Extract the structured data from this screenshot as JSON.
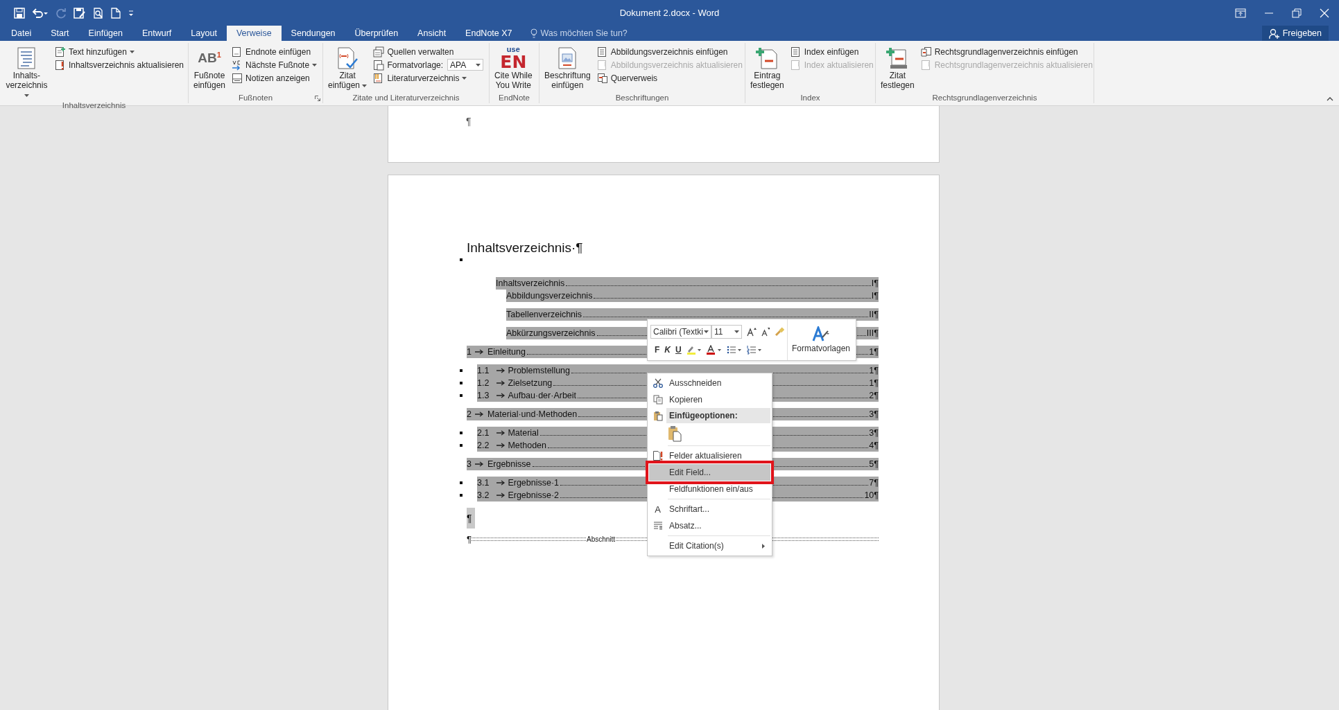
{
  "window": {
    "title": "Dokument 2.docx - Word"
  },
  "tabs": [
    {
      "label": "Datei",
      "selected": false
    },
    {
      "label": "Start",
      "selected": false
    },
    {
      "label": "Einfügen",
      "selected": false
    },
    {
      "label": "Entwurf",
      "selected": false
    },
    {
      "label": "Layout",
      "selected": false
    },
    {
      "label": "Verweise",
      "selected": true
    },
    {
      "label": "Sendungen",
      "selected": false
    },
    {
      "label": "Überprüfen",
      "selected": false
    },
    {
      "label": "Ansicht",
      "selected": false
    },
    {
      "label": "EndNote X7",
      "selected": false
    }
  ],
  "tell_me": {
    "label": "Was möchten Sie tun?"
  },
  "share_button": {
    "label": "Freigeben"
  },
  "ribbon": {
    "groups": [
      {
        "label": "Inhaltsverzeichnis",
        "launcher": false,
        "items": [
          {
            "kind": "large",
            "label": "Inhalts-\nverzeichnis",
            "dropdown": true
          },
          {
            "kind": "stack",
            "items": [
              {
                "kind": "small",
                "label": "Text hinzufügen",
                "dropdown": true,
                "disabled": false
              },
              {
                "kind": "small",
                "label": "Inhaltsverzeichnis aktualisieren",
                "dropdown": false,
                "disabled": false
              }
            ]
          }
        ]
      },
      {
        "label": "Fußnoten",
        "launcher": true,
        "items": [
          {
            "kind": "large",
            "icon_text": "AB",
            "icon_sup": "1",
            "label": "Fußnote\neinfügen",
            "dropdown": false
          },
          {
            "kind": "stack",
            "items": [
              {
                "kind": "small",
                "label": "Endnote einfügen",
                "dropdown": false,
                "disabled": false
              },
              {
                "kind": "small",
                "label": "Nächste Fußnote",
                "dropdown": true,
                "disabled": false
              },
              {
                "kind": "small",
                "label": "Notizen anzeigen",
                "dropdown": false,
                "disabled": false
              }
            ]
          }
        ]
      },
      {
        "label": "Zitate und Literaturverzeichnis",
        "launcher": false,
        "items": [
          {
            "kind": "large",
            "label": "Zitat\neinfügen",
            "dropdown": true
          },
          {
            "kind": "stack",
            "items": [
              {
                "kind": "small",
                "label": "Quellen verwalten",
                "dropdown": false,
                "disabled": false
              },
              {
                "kind": "combo",
                "label": "Formatvorlage:",
                "value": "APA"
              },
              {
                "kind": "small",
                "label": "Literaturverzeichnis",
                "dropdown": true,
                "disabled": false
              }
            ]
          }
        ]
      },
      {
        "label": "EndNote",
        "launcher": false,
        "items": [
          {
            "kind": "logo",
            "logo_top": "use",
            "logo_main": "EN",
            "label": "Cite While\nYou Write",
            "dropdown": false
          }
        ]
      },
      {
        "label": "Beschriftungen",
        "launcher": false,
        "items": [
          {
            "kind": "large",
            "label": "Beschriftung\neinfügen",
            "dropdown": false
          },
          {
            "kind": "stack",
            "items": [
              {
                "kind": "small",
                "label": "Abbildungsverzeichnis einfügen",
                "dropdown": false,
                "disabled": false
              },
              {
                "kind": "small",
                "label": "Abbildungsverzeichnis aktualisieren",
                "dropdown": false,
                "disabled": true
              },
              {
                "kind": "small",
                "label": "Querverweis",
                "dropdown": false,
                "disabled": false
              }
            ]
          }
        ]
      },
      {
        "label": "Index",
        "launcher": false,
        "items": [
          {
            "kind": "large",
            "label": "Eintrag\nfestlegen",
            "dropdown": false
          },
          {
            "kind": "stack",
            "items": [
              {
                "kind": "small",
                "label": "Index einfügen",
                "dropdown": false,
                "disabled": false
              },
              {
                "kind": "small",
                "label": "Index aktualisieren",
                "dropdown": false,
                "disabled": true
              }
            ]
          }
        ]
      },
      {
        "label": "Rechtsgrundlagenverzeichnis",
        "launcher": false,
        "items": [
          {
            "kind": "large",
            "label": "Zitat\nfestlegen",
            "dropdown": false
          },
          {
            "kind": "stack",
            "items": [
              {
                "kind": "small",
                "label": "Rechtsgrundlagenverzeichnis einfügen",
                "dropdown": false,
                "disabled": false
              },
              {
                "kind": "small",
                "label": "Rechtsgrundlagenverzeichnis aktualisieren",
                "dropdown": false,
                "disabled": true
              }
            ]
          }
        ]
      }
    ]
  },
  "document": {
    "page1_mark": "¶",
    "heading": "Inhaltsverzeichnis·¶",
    "toc": [
      {
        "kind": "front",
        "title": "Inhaltsverzeichnis",
        "page": "I¶",
        "children": [
          {
            "title": "Abbildungsverzeichnis",
            "page": "I¶"
          },
          {
            "title": "Tabellenverzeichnis",
            "page": "II¶"
          },
          {
            "title": "Abkürzungsverzeichnis",
            "page": "III¶"
          }
        ]
      },
      {
        "kind": "chapter",
        "number": "1",
        "title": "Einleitung",
        "page": "1¶",
        "children": [
          {
            "number": "1.1",
            "title": "Problemstellung",
            "page": "1¶"
          },
          {
            "number": "1.2",
            "title": "Zielsetzung",
            "page": "1¶"
          },
          {
            "number": "1.3",
            "title": "Aufbau·der·Arbeit",
            "page": "2¶"
          }
        ]
      },
      {
        "kind": "chapter",
        "number": "2",
        "title": "Material·und·Methoden",
        "page": "3¶",
        "children": [
          {
            "number": "2.1",
            "title": "Material",
            "page": "3¶"
          },
          {
            "number": "2.2",
            "title": "Methoden",
            "page": "4¶"
          }
        ]
      },
      {
        "kind": "chapter",
        "number": "3",
        "title": "Ergebnisse",
        "page": "5¶",
        "children": [
          {
            "number": "3.1",
            "title": "Ergebnisse·1",
            "page": "7¶"
          },
          {
            "number": "3.2",
            "title": "Ergebnisse·2",
            "page": "10¶"
          }
        ]
      }
    ],
    "empty_paragraph": "¶",
    "section_break": {
      "mark": "¶",
      "label": "Abschnitt"
    }
  },
  "mini_toolbar": {
    "font": "Calibri (Textki",
    "size": "11",
    "bold": "F",
    "italic": "K",
    "underline": "U",
    "styles": "Formatvorlagen"
  },
  "context_menu": {
    "items": [
      {
        "kind": "item",
        "label": "Ausschneiden",
        "selected": false,
        "outlined": false
      },
      {
        "kind": "item",
        "label": "Kopieren",
        "selected": false,
        "outlined": false
      },
      {
        "kind": "header",
        "label": "Einfügeoptionen:"
      },
      {
        "kind": "paste"
      },
      {
        "kind": "separator"
      },
      {
        "kind": "item",
        "label": "Felder aktualisieren",
        "selected": false,
        "outlined": false
      },
      {
        "kind": "item",
        "label": "Edit Field...",
        "selected": true,
        "outlined": true
      },
      {
        "kind": "item",
        "label": "Feldfunktionen ein/aus",
        "selected": false,
        "outlined": false
      },
      {
        "kind": "separator"
      },
      {
        "kind": "item",
        "label": "Schriftart...",
        "icon_text": "A",
        "selected": false,
        "outlined": false
      },
      {
        "kind": "item",
        "label": "Absatz...",
        "selected": false,
        "outlined": false
      },
      {
        "kind": "separator"
      },
      {
        "kind": "submenu",
        "label": "Edit Citation(s)",
        "selected": false,
        "outlined": false
      }
    ]
  }
}
